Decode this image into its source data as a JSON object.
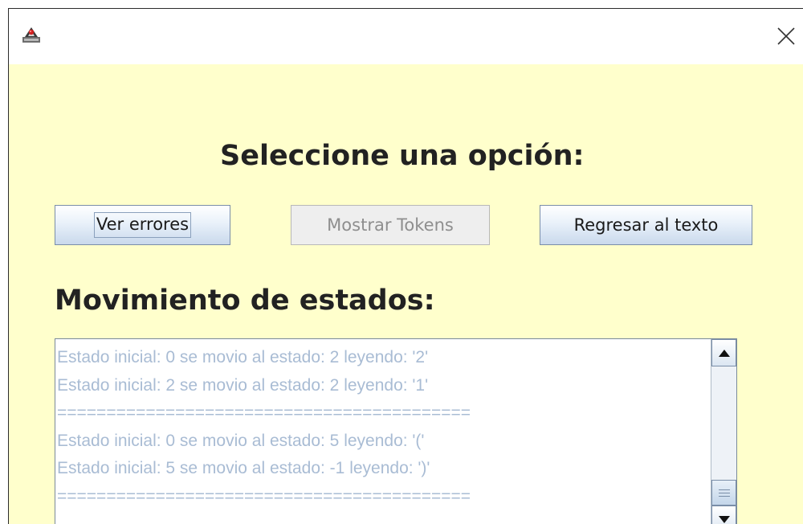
{
  "dialog": {
    "heading": "Seleccione una opción:",
    "subheading": "Movimiento de estados:"
  },
  "buttons": {
    "errors_label": "Ver errores",
    "tokens_label": "Mostrar Tokens",
    "back_label": "Regresar al texto"
  },
  "output": {
    "lines": [
      "Estado inicial: 0 se movio al estado: 2 leyendo: '2'",
      "Estado inicial: 2 se movio al estado: 2 leyendo: '1'",
      "==========================================",
      "Estado inicial: 0 se movio al estado: 5 leyendo: '('",
      "Estado inicial: 5 se movio al estado: -1 leyendo: ')'",
      "=========================================="
    ]
  },
  "icons": {
    "app": "java-app-icon",
    "close": "close-icon",
    "scroll_up": "arrow-up-icon",
    "scroll_down": "arrow-down-icon"
  },
  "colors": {
    "background": "#ffffcc",
    "text_output": "#a9bcd4",
    "heading": "#222222",
    "disabled_text": "#8e8e8e"
  }
}
